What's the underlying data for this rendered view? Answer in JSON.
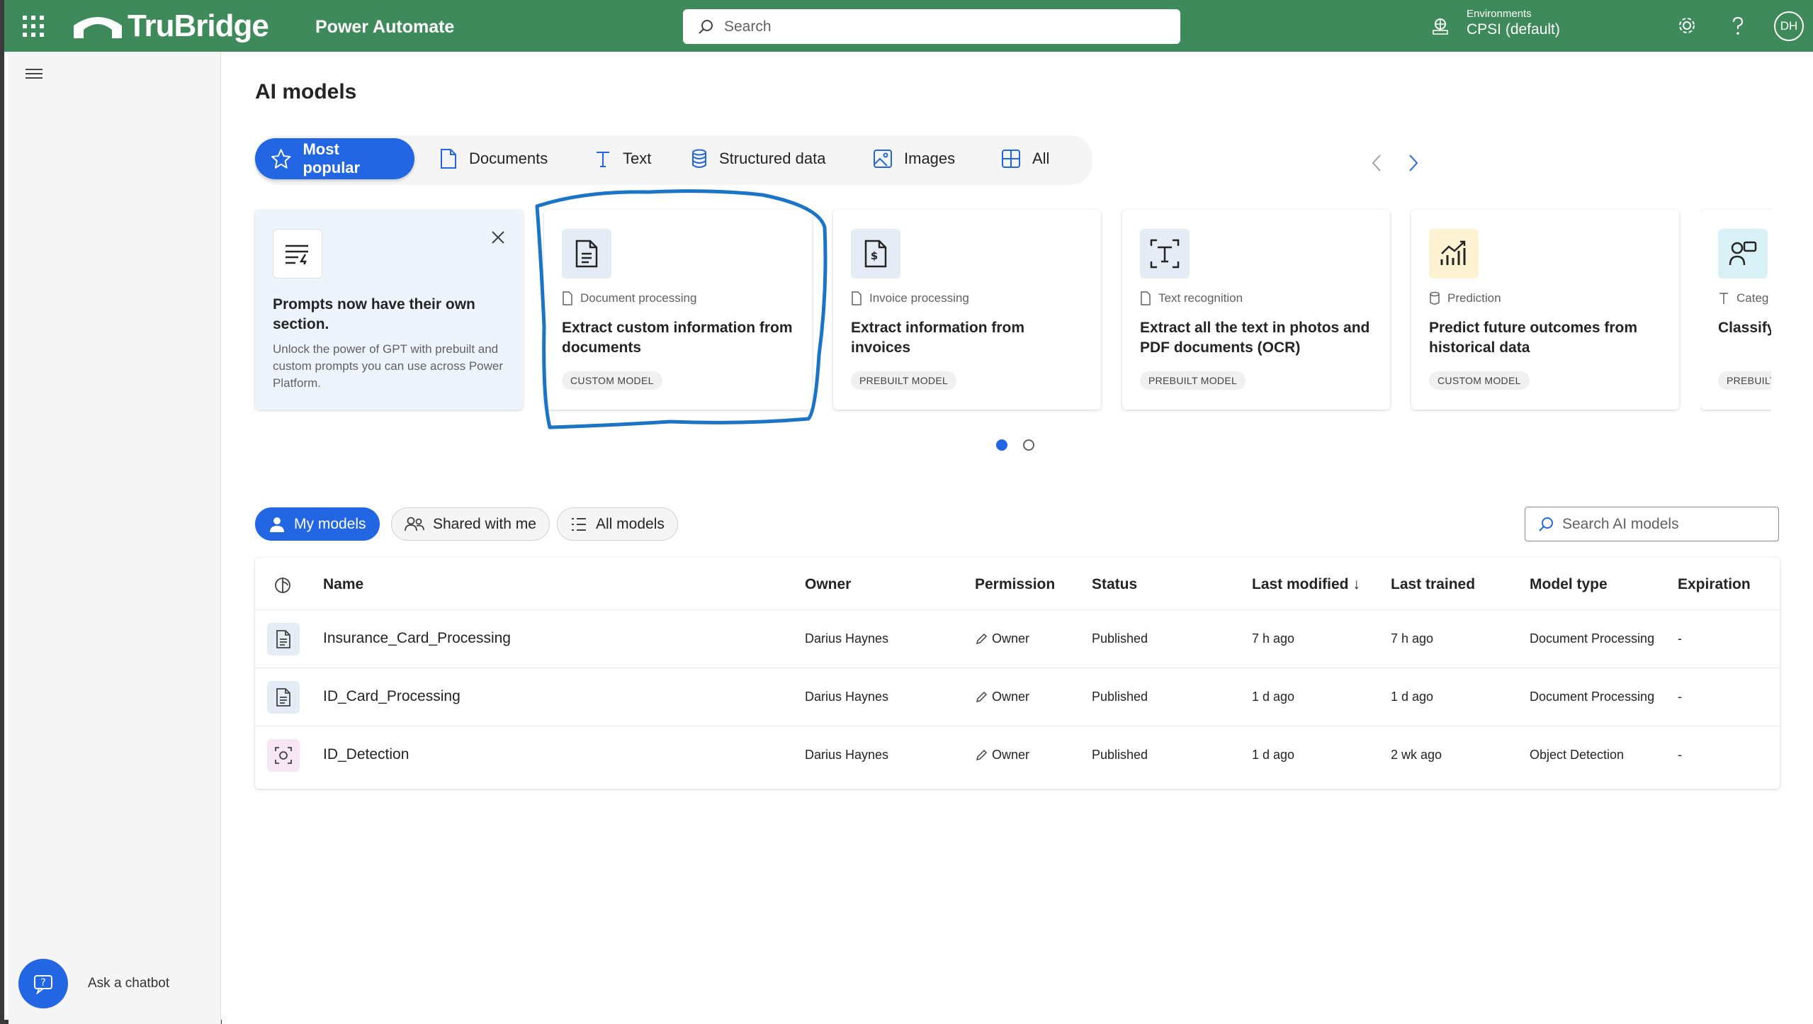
{
  "header": {
    "brand": "TruBridge",
    "app_name": "Power Automate",
    "search_placeholder": "Search",
    "env_label": "Environments",
    "env_value": "CPSI (default)",
    "avatar_initials": "DH",
    "color": "#3f8a5a"
  },
  "rail": {
    "chatbot_label": "Ask a chatbot"
  },
  "page": {
    "title": "AI models"
  },
  "category_tabs": [
    {
      "label": "Most popular",
      "icon": "star-icon",
      "active": true
    },
    {
      "label": "Documents",
      "icon": "document-icon"
    },
    {
      "label": "Text",
      "icon": "text-icon"
    },
    {
      "label": "Structured data",
      "icon": "database-icon"
    },
    {
      "label": "Images",
      "icon": "image-icon"
    },
    {
      "label": "All",
      "icon": "grid-icon"
    }
  ],
  "promo_card": {
    "title": "Prompts now have their own section.",
    "description": "Unlock the power of GPT with prebuilt and custom prompts you can use across Power Platform."
  },
  "cards": [
    {
      "category": "Document processing",
      "title": "Extract custom information from documents",
      "badge": "CUSTOM MODEL",
      "icon": "document-processing-icon"
    },
    {
      "category": "Invoice processing",
      "title": "Extract information from invoices",
      "badge": "PREBUILT MODEL",
      "icon": "invoice-icon"
    },
    {
      "category": "Text recognition",
      "title": "Extract all the text in photos and PDF documents (OCR)",
      "badge": "PREBUILT MODEL",
      "icon": "text-recognition-icon"
    },
    {
      "category": "Prediction",
      "title": "Predict future outcomes from historical data",
      "badge": "CUSTOM MODEL",
      "icon": "prediction-icon"
    },
    {
      "category": "Categ",
      "title": "Classify predefi",
      "badge": "PREBUILT",
      "icon": "classify-icon"
    }
  ],
  "filters": {
    "my_models": "My models",
    "shared": "Shared with me",
    "all": "All models",
    "search_placeholder": "Search AI models"
  },
  "table": {
    "columns": {
      "name": "Name",
      "owner": "Owner",
      "permission": "Permission",
      "status": "Status",
      "last_modified": "Last modified",
      "last_modified_sort": "↓",
      "last_trained": "Last trained",
      "model_type": "Model type",
      "expiration": "Expiration"
    },
    "rows": [
      {
        "name": "Insurance_Card_Processing",
        "owner": "Darius Haynes",
        "permission": "Owner",
        "status": "Published",
        "last_modified": "7 h ago",
        "last_trained": "7 h ago",
        "model_type": "Document Processing",
        "expiration": "-"
      },
      {
        "name": "ID_Card_Processing",
        "owner": "Darius Haynes",
        "permission": "Owner",
        "status": "Published",
        "last_modified": "1 d ago",
        "last_trained": "1 d ago",
        "model_type": "Document Processing",
        "expiration": "-"
      },
      {
        "name": "ID_Detection",
        "owner": "Darius Haynes",
        "permission": "Owner",
        "status": "Published",
        "last_modified": "1 d ago",
        "last_trained": "2 wk ago",
        "model_type": "Object Detection",
        "expiration": "-"
      }
    ]
  }
}
